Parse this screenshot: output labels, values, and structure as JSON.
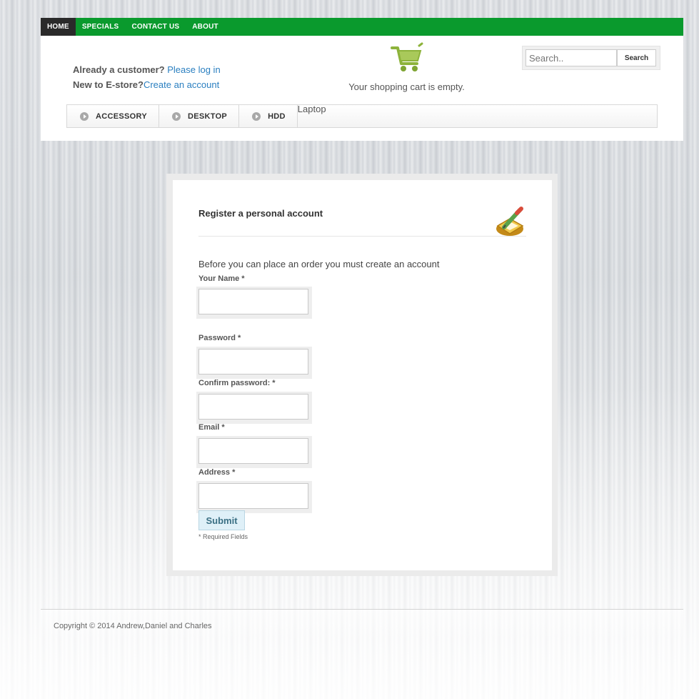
{
  "nav": {
    "items": [
      "HOME",
      "SPECIALS",
      "CONTACT US",
      "ABOUT"
    ],
    "active": "HOME"
  },
  "account": {
    "customer_prompt": "Already a customer?",
    "login_link": "Please log in",
    "new_prompt": "New to E-store?",
    "create_link": "Create an account"
  },
  "cart": {
    "status": "Your shopping cart is empty.",
    "icon": "shopping-cart-icon"
  },
  "search": {
    "placeholder": "Search..",
    "button": "Search"
  },
  "categories": [
    "ACCESSORY",
    "DESKTOP",
    "HDD"
  ],
  "category_plain": "Laptop",
  "register": {
    "title": "Register a personal account",
    "icon": "register-pencil-icon",
    "intro": "Before you can place an order you must create an account",
    "fields": {
      "name": "Your Name *",
      "password": "Password *",
      "confirm": "Confirm password: *",
      "email": "Email *",
      "address": "Address *"
    },
    "submit": "Submit",
    "required_note": "* Required Fields"
  },
  "footer": {
    "copyright": "Copyright © 2014 Andrew,Daniel and Charles"
  },
  "colors": {
    "nav_green": "#0a9a2d",
    "nav_active": "#2a2a2a",
    "link_blue": "#2a7fc0",
    "cart_green": "#8db33b"
  }
}
